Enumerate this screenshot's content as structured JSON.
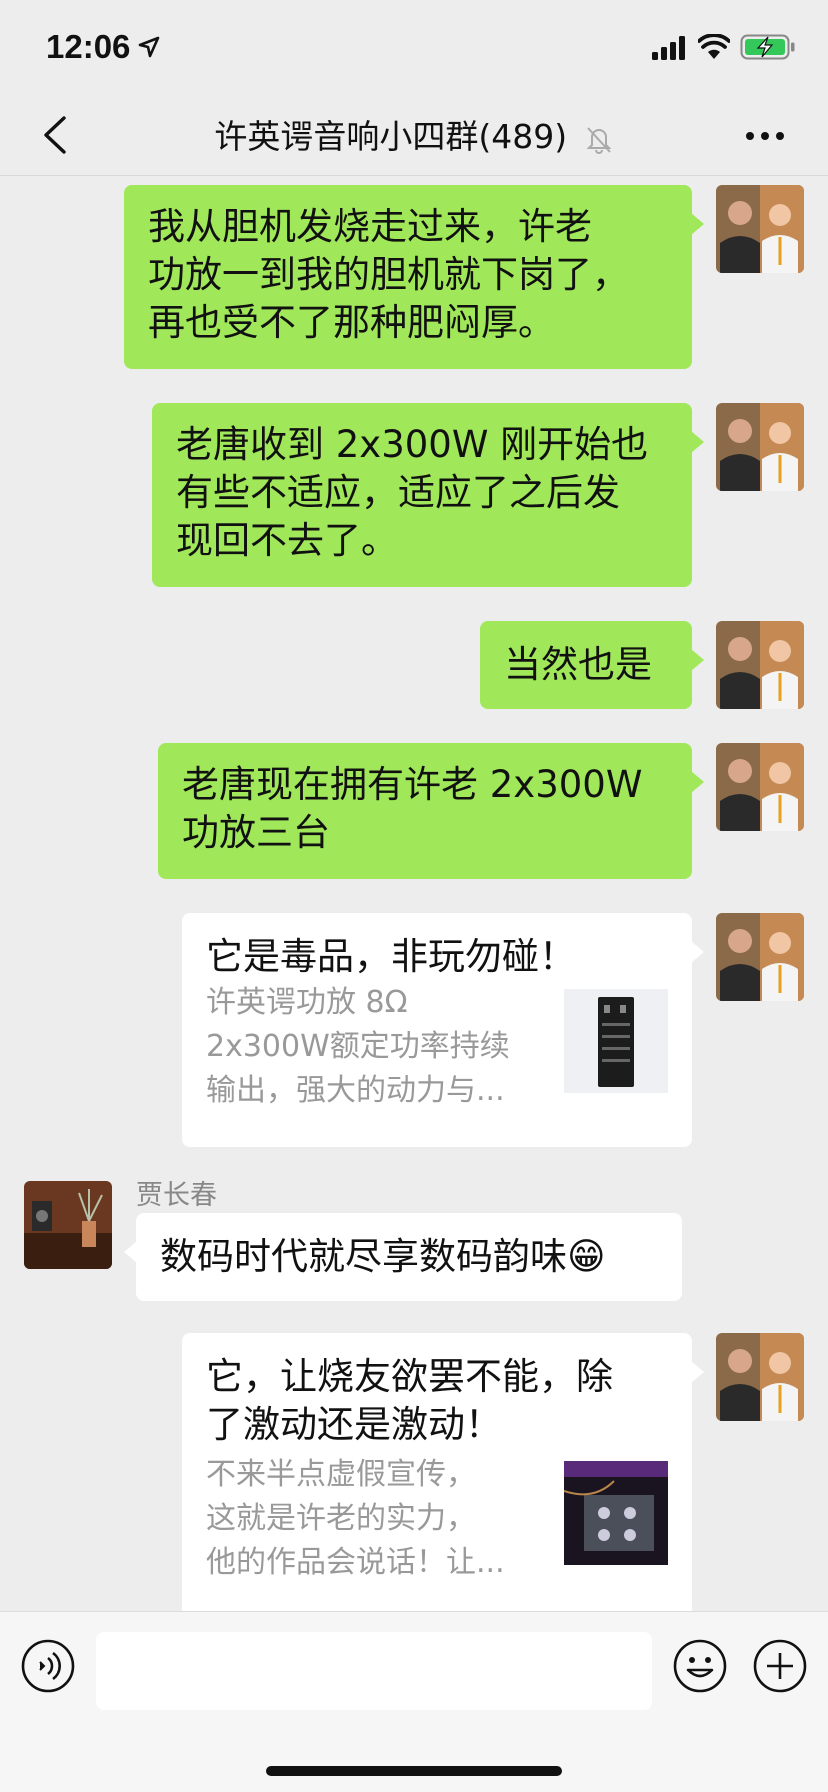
{
  "status_bar": {
    "time": "12:06",
    "icons": [
      "location-arrow-icon",
      "cellular-signal-icon",
      "wifi-icon",
      "battery-charging-icon"
    ]
  },
  "nav": {
    "back_icon": "chevron-left-icon",
    "title": "许英谔音响小四群(489)",
    "mute_icon": "bell-muted-icon",
    "more_icon": "ellipsis-icon"
  },
  "messages": [
    {
      "sender": "me",
      "text": "我从胆机发烧走过来，许老\n功放一到我的胆机就下岗了，\n再也受不了那种肥闷厚。"
    },
    {
      "sender": "me",
      "text": "老唐收到 2x300W 刚开始也\n有些不适应，适应了之后发\n现回不去了。"
    },
    {
      "sender": "me",
      "text": "当然也是"
    },
    {
      "sender": "me",
      "text": "老唐现在拥有许老 2x300W\n功放三台"
    },
    {
      "sender": "me",
      "type": "link",
      "title": "它是毒品，非玩勿碰！",
      "desc": "许英谔功放 8Ω\n2x300W额定功率持续\n输出，强大的动力与..."
    },
    {
      "sender": "other",
      "name": "贾长春",
      "text": "数码时代就尽享数码韵味😁"
    },
    {
      "sender": "me",
      "type": "link",
      "title": "它，让烧友欲罢不能，除\n了激动还是激动！",
      "desc": "不来半点虚假宣传，\n这就是许老的实力，\n他的作品会说话！让..."
    }
  ],
  "input_bar": {
    "voice_icon": "voice-icon",
    "placeholder": "",
    "emoji_icon": "emoji-icon",
    "plus_icon": "plus-circle-icon"
  },
  "colors": {
    "background": "#ededed",
    "my_bubble": "#a0e75a",
    "other_bubble": "#ffffff",
    "secondary_text": "#999999"
  }
}
